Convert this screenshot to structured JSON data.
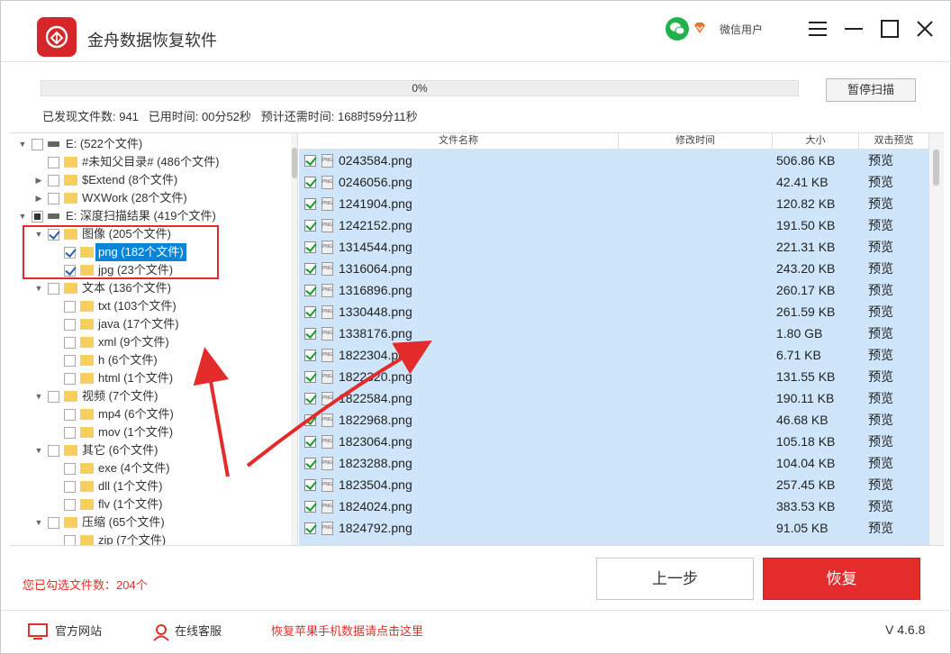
{
  "app": {
    "title": "金舟数据恢复软件",
    "user": "微信用户",
    "version": "V 4.6.8"
  },
  "progress": {
    "percent_text": "0%",
    "value": 0
  },
  "pause_button": "暂停扫描",
  "status": {
    "found": "已发现文件数: 941",
    "elapsed": "已用时间: 00分52秒",
    "remaining": "预计还需时间: 168时59分11秒"
  },
  "tree": [
    {
      "label": "E:   (522个文件)",
      "type": "drive",
      "expand": "▼",
      "check": "none"
    },
    {
      "label": "#未知父目录#   (486个文件)",
      "type": "folder",
      "expand": "",
      "check": "none"
    },
    {
      "label": "$Extend   (8个文件)",
      "type": "folder",
      "expand": "▶",
      "check": "none"
    },
    {
      "label": "WXWork   (28个文件)",
      "type": "folder",
      "expand": "▶",
      "check": "none"
    },
    {
      "label": "E: 深度扫描结果   (419个文件)",
      "type": "drive",
      "expand": "▼",
      "check": "partial"
    },
    {
      "label": "图像   (205个文件)",
      "type": "folder",
      "expand": "▼",
      "check": "checked"
    },
    {
      "label": "png   (182个文件)",
      "type": "folder",
      "expand": "",
      "check": "checked",
      "selected": true
    },
    {
      "label": "jpg   (23个文件)",
      "type": "folder",
      "expand": "",
      "check": "checked"
    },
    {
      "label": "文本   (136个文件)",
      "type": "folder",
      "expand": "▼",
      "check": "none"
    },
    {
      "label": "txt   (103个文件)",
      "type": "folder",
      "expand": "",
      "check": "none"
    },
    {
      "label": "java   (17个文件)",
      "type": "folder",
      "expand": "",
      "check": "none"
    },
    {
      "label": "xml   (9个文件)",
      "type": "folder",
      "expand": "",
      "check": "none"
    },
    {
      "label": "h   (6个文件)",
      "type": "folder",
      "expand": "",
      "check": "none"
    },
    {
      "label": "html   (1个文件)",
      "type": "folder",
      "expand": "",
      "check": "none"
    },
    {
      "label": "视频   (7个文件)",
      "type": "folder",
      "expand": "▼",
      "check": "none"
    },
    {
      "label": "mp4   (6个文件)",
      "type": "folder",
      "expand": "",
      "check": "none"
    },
    {
      "label": "mov   (1个文件)",
      "type": "folder",
      "expand": "",
      "check": "none"
    },
    {
      "label": "其它   (6个文件)",
      "type": "folder",
      "expand": "▼",
      "check": "none"
    },
    {
      "label": "exe   (4个文件)",
      "type": "folder",
      "expand": "",
      "check": "none"
    },
    {
      "label": "dll   (1个文件)",
      "type": "folder",
      "expand": "",
      "check": "none"
    },
    {
      "label": "flv   (1个文件)",
      "type": "folder",
      "expand": "",
      "check": "none"
    },
    {
      "label": "压缩   (65个文件)",
      "type": "folder",
      "expand": "▼",
      "check": "none"
    },
    {
      "label": "zip   (7个文件)",
      "type": "folder",
      "expand": "",
      "check": "none"
    }
  ],
  "list_header": {
    "name": "文件名称",
    "modified": "修改时间",
    "size": "大小",
    "preview": "双击预览"
  },
  "files": [
    {
      "name": "0243584.png",
      "size": "506.86 KB",
      "preview": "预览"
    },
    {
      "name": "0246056.png",
      "size": "42.41 KB",
      "preview": "预览"
    },
    {
      "name": "1241904.png",
      "size": "120.82 KB",
      "preview": "预览"
    },
    {
      "name": "1242152.png",
      "size": "191.50 KB",
      "preview": "预览"
    },
    {
      "name": "1314544.png",
      "size": "221.31 KB",
      "preview": "预览"
    },
    {
      "name": "1316064.png",
      "size": "243.20 KB",
      "preview": "预览"
    },
    {
      "name": "1316896.png",
      "size": "260.17 KB",
      "preview": "预览"
    },
    {
      "name": "1330448.png",
      "size": "261.59 KB",
      "preview": "预览"
    },
    {
      "name": "1338176.png",
      "size": "1.80 GB",
      "preview": "预览"
    },
    {
      "name": "1822304.png",
      "size": "6.71 KB",
      "preview": "预览"
    },
    {
      "name": "1822320.png",
      "size": "131.55 KB",
      "preview": "预览"
    },
    {
      "name": "1822584.png",
      "size": "190.11 KB",
      "preview": "预览"
    },
    {
      "name": "1822968.png",
      "size": "46.68 KB",
      "preview": "预览"
    },
    {
      "name": "1823064.png",
      "size": "105.18 KB",
      "preview": "预览"
    },
    {
      "name": "1823288.png",
      "size": "104.04 KB",
      "preview": "预览"
    },
    {
      "name": "1823504.png",
      "size": "257.45 KB",
      "preview": "预览"
    },
    {
      "name": "1824024.png",
      "size": "383.53 KB",
      "preview": "预览"
    },
    {
      "name": "1824792.png",
      "size": "91.05 KB",
      "preview": "预览"
    }
  ],
  "selected_count": "您已勾选文件数：204个",
  "buttons": {
    "prev": "上一步",
    "recover": "恢复"
  },
  "footer": {
    "website": "官方网站",
    "support": "在线客服",
    "apple_link": "恢复苹果手机数据请点击这里"
  },
  "colors": {
    "accent_red": "#e42c2c",
    "selection_blue": "#0a84d6",
    "list_bg": "#cfe6fa",
    "annotation_red": "#e32b2b"
  },
  "icons": [
    "app-logo-icon",
    "wechat-icon",
    "vip-icon",
    "menu-icon",
    "maximize-icon",
    "close-icon",
    "monitor-icon",
    "user-icon"
  ]
}
